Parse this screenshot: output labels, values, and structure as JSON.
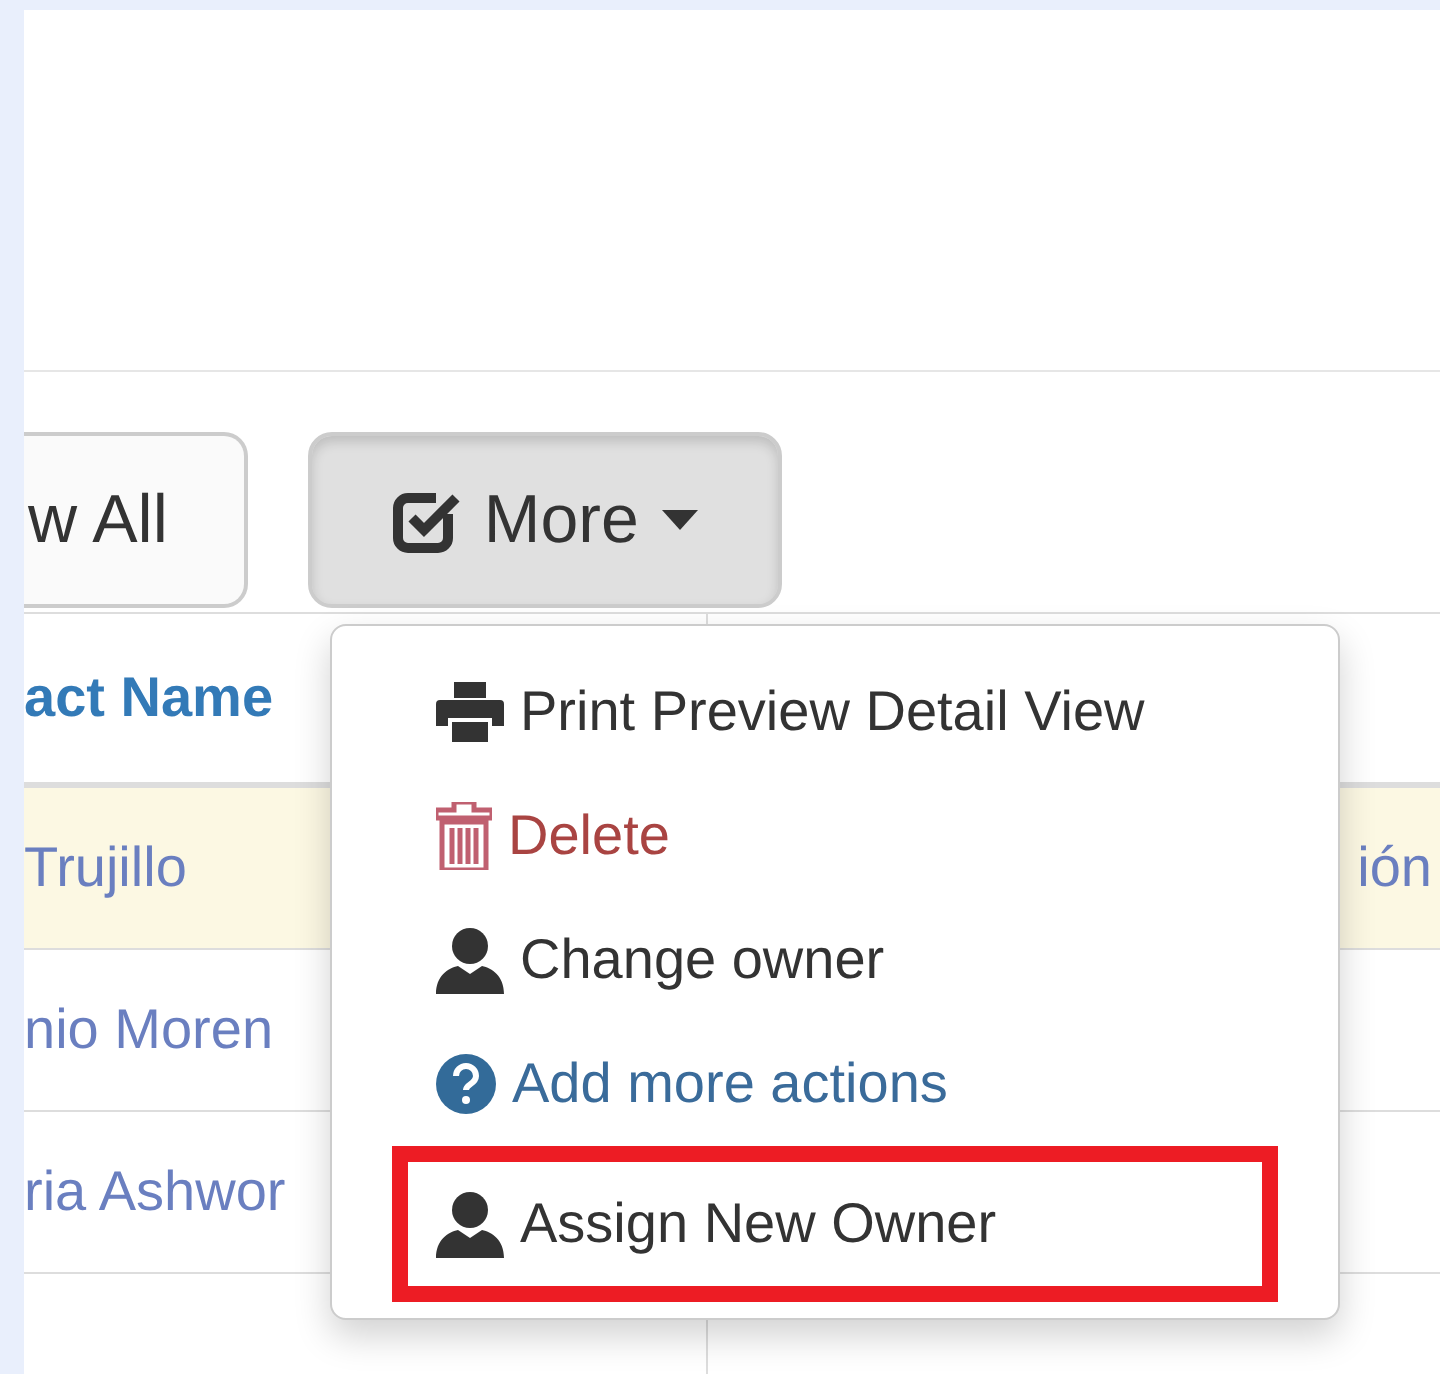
{
  "toolbar": {
    "buttons": [
      {
        "label": "w All",
        "kind": "plain",
        "pressed": false
      },
      {
        "label": "More",
        "kind": "dropdown",
        "pressed": true
      }
    ]
  },
  "table": {
    "columns": [
      "act Name",
      ""
    ],
    "rows": [
      {
        "cells": [
          "Trujillo",
          "ión"
        ],
        "selected": true
      },
      {
        "cells": [
          "nio Moren",
          ""
        ],
        "selected": false
      },
      {
        "cells": [
          "ria Ashwor",
          ""
        ],
        "selected": false
      },
      {
        "cells": [
          "",
          ""
        ],
        "selected": false
      }
    ]
  },
  "menu": {
    "items": [
      {
        "label": "Print Preview Detail View",
        "kind": "print",
        "danger": false,
        "highlighted": false
      },
      {
        "label": "Delete",
        "kind": "trash",
        "danger": true,
        "highlighted": false
      },
      {
        "label": "Change owner",
        "kind": "user",
        "danger": false,
        "highlighted": false
      },
      {
        "label": "Add more actions",
        "kind": "help",
        "danger": false,
        "highlighted": false
      },
      {
        "label": "Assign New Owner",
        "kind": "user",
        "danger": false,
        "highlighted": true
      }
    ]
  }
}
